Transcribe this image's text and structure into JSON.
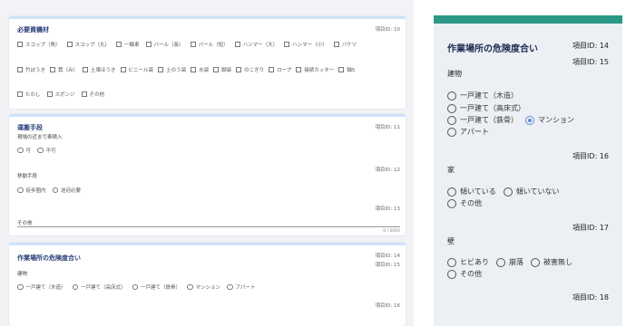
{
  "left": {
    "card1": {
      "title": "必要資機材",
      "id": "項目ID: 10",
      "rows": [
        [
          "スコップ（角）",
          "スコップ（丸）",
          "一輪車",
          "バール（長）",
          "バール（短）",
          "ハンマー（大）",
          "ハンマー（小）",
          "バケツ"
        ],
        [
          "竹ぼうき",
          "箕（み）",
          "土壌ほうき",
          "ビニール袋",
          "土のう袋",
          "水袋",
          "脚袋",
          "のこぎり",
          "ロープ",
          "接続カッター",
          "軸5"
        ],
        [
          "たわし",
          "スポンジ",
          "その他"
        ]
      ]
    },
    "card2": {
      "title": "運搬手段",
      "id1": "項目ID: 11",
      "label1": "現場の近まで車積入",
      "opts1": [
        "可",
        "不可"
      ],
      "id2": "項目ID: 12",
      "label2": "移動手段",
      "opts2": [
        "徒歩圏内",
        "送迎必要"
      ],
      "id3": "項目ID: 13",
      "label3": "その他",
      "counter": "0 / 6000"
    },
    "card3": {
      "title": "作業場所の危険度合い",
      "id1": "項目ID: 14",
      "id2": "項目ID: 15",
      "label": "建物",
      "opts": [
        "一戸建て（木造）",
        "一戸建て（高床式）",
        "一戸建て（鉄骨）",
        "マンション",
        "アパート"
      ],
      "id3": "項目ID: 16"
    }
  },
  "right": {
    "title": "作業場所の危険度合い",
    "id14": "項目ID: 14",
    "id15": "項目ID: 15",
    "q1": "建物",
    "q1_opts": [
      "一戸建て（木造）",
      "一戸建て（高床式）",
      "一戸建て（鉄骨）",
      "マンション",
      "アパート"
    ],
    "id16": "項目ID: 16",
    "q2": "家",
    "q2_opts": [
      "傾いている",
      "傾いていない",
      "その他"
    ],
    "id17": "項目ID: 17",
    "q3": "壁",
    "q3_opts": [
      "ヒビあり",
      "崩落",
      "被害無し",
      "その他"
    ],
    "id18": "項目ID: 18"
  },
  "colors": {
    "topbar": "#2b9886",
    "title": "#1e2a52",
    "selected": "#5b8fd6"
  }
}
